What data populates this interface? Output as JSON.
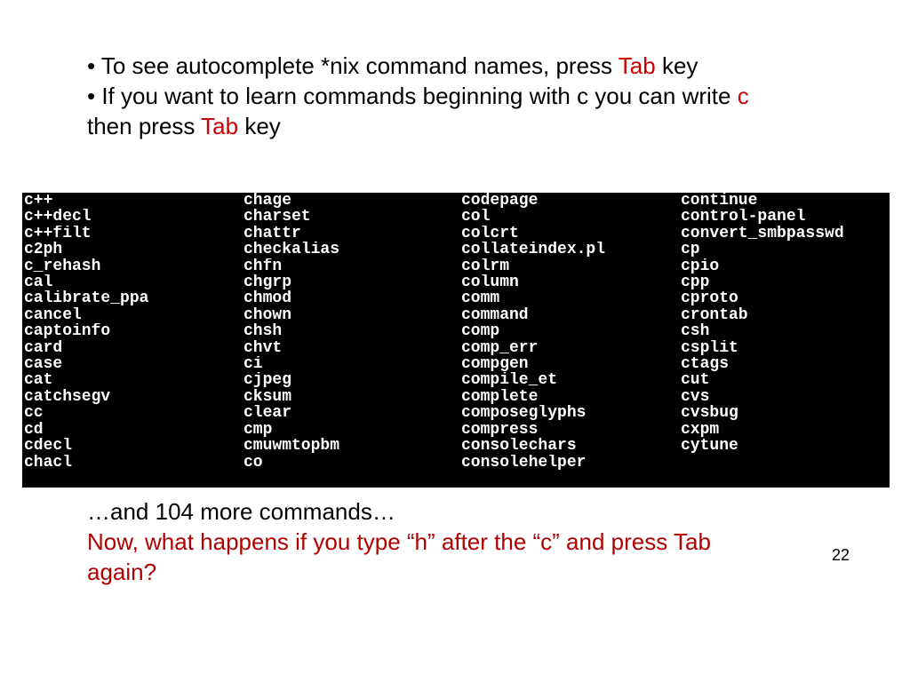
{
  "bullet1": {
    "prefix": "• To see autocomplete *nix command names, press ",
    "highlight": "Tab",
    "suffix": " key"
  },
  "bullet2": {
    "prefix": "• If you want to learn commands beginning with c you can write ",
    "hl1": "c",
    "mid": " then press ",
    "hl2": "Tab",
    "suffix": " key"
  },
  "terminal": {
    "columns": [
      [
        "c++",
        "c++decl",
        "c++filt",
        "c2ph",
        "c_rehash",
        "cal",
        "calibrate_ppa",
        "cancel",
        "captoinfo",
        "card",
        "case",
        "cat",
        "catchsegv",
        "cc",
        "cd",
        "cdecl",
        "chacl"
      ],
      [
        "chage",
        "charset",
        "chattr",
        "checkalias",
        "chfn",
        "chgrp",
        "chmod",
        "chown",
        "chsh",
        "chvt",
        "ci",
        "cjpeg",
        "cksum",
        "clear",
        "cmp",
        "cmuwmtopbm",
        "co"
      ],
      [
        "codepage",
        "col",
        "colcrt",
        "collateindex.pl",
        "colrm",
        "column",
        "comm",
        "command",
        "comp",
        "comp_err",
        "compgen",
        "compile_et",
        "complete",
        "composeglyphs",
        "compress",
        "consolechars",
        "consolehelper"
      ],
      [
        "continue",
        "control-panel",
        "convert_smbpasswd",
        "cp",
        "cpio",
        "cpp",
        "cproto",
        "crontab",
        "csh",
        "csplit",
        "ctags",
        "cut",
        "cvs",
        "cvsbug",
        "cxpm",
        "cytune",
        ""
      ]
    ]
  },
  "bottom": {
    "more": "…and 104 more commands…",
    "question": "Now, what happens if you type “h” after the “c” and press Tab again?"
  },
  "page_number": "22"
}
